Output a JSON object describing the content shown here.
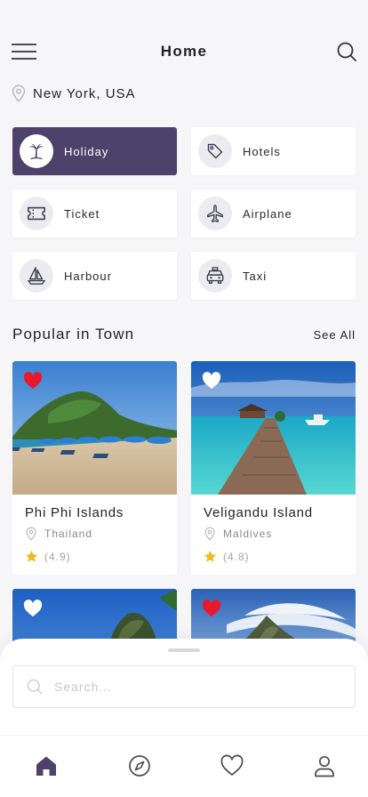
{
  "header": {
    "title": "Home",
    "menu_icon": "hamburger-menu-icon",
    "search_icon": "search-icon"
  },
  "location": {
    "icon": "location-pin-icon",
    "text": "New York, USA"
  },
  "categories": [
    {
      "label": "Holiday",
      "icon": "palm-tree-icon",
      "active": true
    },
    {
      "label": "Hotels",
      "icon": "tag-icon",
      "active": false
    },
    {
      "label": "Ticket",
      "icon": "ticket-icon",
      "active": false
    },
    {
      "label": "Airplane",
      "icon": "airplane-icon",
      "active": false
    },
    {
      "label": "Harbour",
      "icon": "sailboat-icon",
      "active": false
    },
    {
      "label": "Taxi",
      "icon": "taxi-icon",
      "active": false
    }
  ],
  "popular": {
    "title": "Popular in Town",
    "see_all": "See All",
    "cards": [
      {
        "title": "Phi Phi Islands",
        "location": "Thailand",
        "rating": "(4.9)",
        "favorite": true
      },
      {
        "title": "Veligandu Island",
        "location": "Maldives",
        "rating": "(4.8)",
        "favorite": false
      },
      {
        "title": "",
        "location": "",
        "rating": "",
        "favorite": false
      },
      {
        "title": "",
        "location": "",
        "rating": "",
        "favorite": true
      }
    ]
  },
  "search": {
    "placeholder": "Search..."
  },
  "bottom_nav": [
    {
      "name": "home",
      "icon": "home-icon",
      "active": true
    },
    {
      "name": "explore",
      "icon": "compass-icon",
      "active": false
    },
    {
      "name": "favorites",
      "icon": "heart-icon",
      "active": false
    },
    {
      "name": "profile",
      "icon": "user-icon",
      "active": false
    }
  ],
  "colors": {
    "accent": "#4d426b",
    "favorite": "#e8192c",
    "star": "#f5b819",
    "background": "#f6f6f8"
  }
}
